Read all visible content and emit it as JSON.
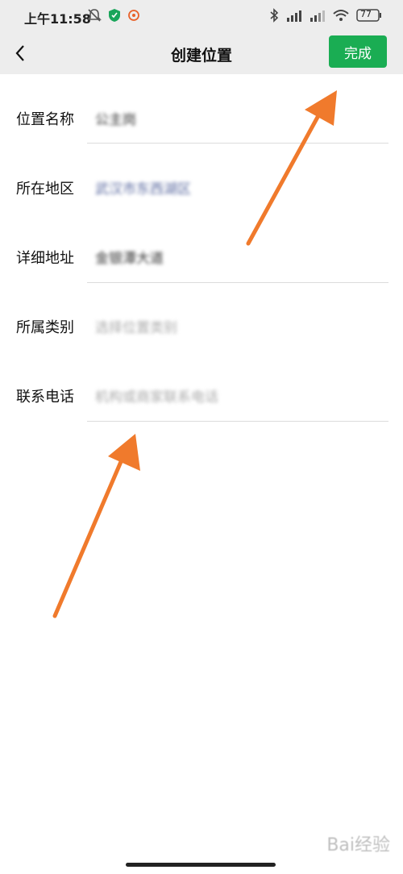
{
  "status_bar": {
    "time": "上午11:58",
    "battery": "77"
  },
  "header": {
    "back_icon": "chevron-left-icon",
    "title": "创建位置",
    "done_label": "完成",
    "accent_color": "#1aad53"
  },
  "form": {
    "location_name": {
      "label": "位置名称",
      "value": "公主岗"
    },
    "region": {
      "label": "所在地区",
      "value": "武汉市东西湖区"
    },
    "address": {
      "label": "详细地址",
      "value": "金银潭大道"
    },
    "category": {
      "label": "所属类别",
      "placeholder": "选择位置类别"
    },
    "phone": {
      "label": "联系电话",
      "placeholder": "机构或商家联系电话"
    }
  },
  "watermark": "Bai经验",
  "annotation_color": "#f07a2c"
}
